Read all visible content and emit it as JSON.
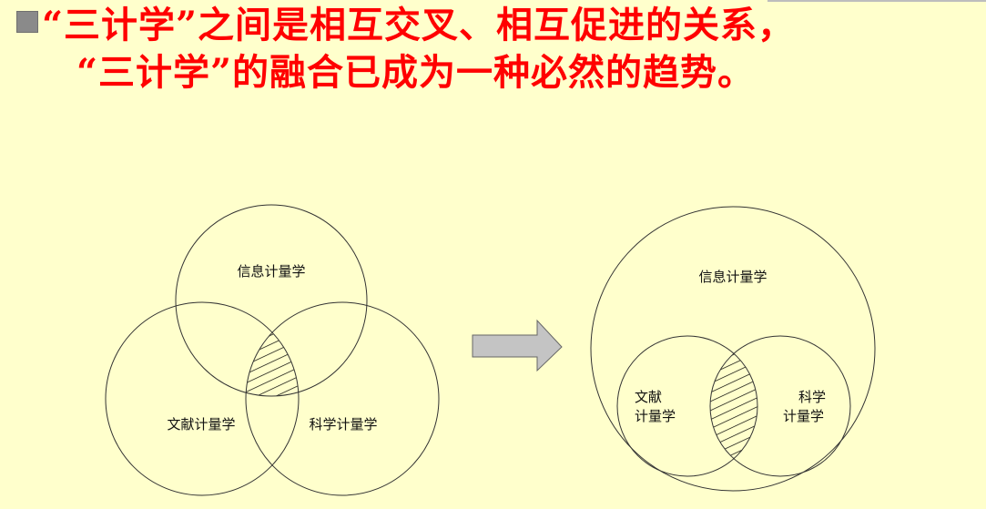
{
  "heading": {
    "line1": "“三计学”之间是相互交叉、相互促进的关系，",
    "line2": "“三计学”的融合已成为一种必然的趋势。",
    "color": "#ff0000"
  },
  "background_color": "#ffffcc",
  "bullet_icon": "square-bullet",
  "arrow_icon": "right-arrow",
  "left_diagram": {
    "top_circle": "信息计量学",
    "left_circle": "文献计量学",
    "right_circle": "科学计量学"
  },
  "right_diagram": {
    "outer_circle": "信息计量学",
    "left_circle_line1": "文献",
    "left_circle_line2": "计量学",
    "right_circle_line1": "科学",
    "right_circle_line2": "计量学"
  }
}
